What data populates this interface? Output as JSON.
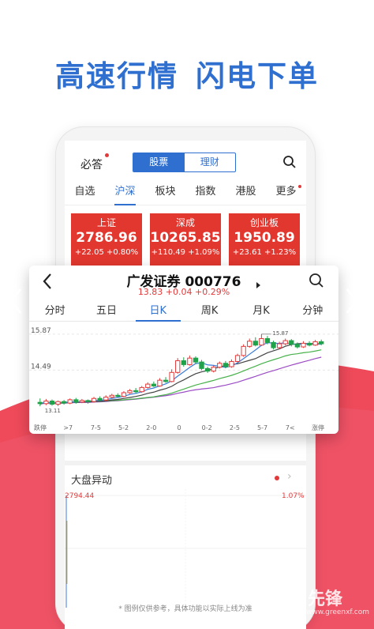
{
  "headline": {
    "left": "高速行情",
    "right": "闪电下单"
  },
  "app": {
    "bida_label": "必答",
    "segment": [
      {
        "label": "股票",
        "active": true
      },
      {
        "label": "理财",
        "active": false
      }
    ],
    "tabs": [
      {
        "label": "自选",
        "active": false
      },
      {
        "label": "沪深",
        "active": true
      },
      {
        "label": "板块",
        "active": false
      },
      {
        "label": "指数",
        "active": false
      },
      {
        "label": "港股",
        "active": false
      },
      {
        "label": "更多",
        "active": false
      }
    ],
    "indices": [
      {
        "name": "上证",
        "value": "2786.96",
        "change": "+22.05",
        "pct": "+0.80%"
      },
      {
        "name": "深成",
        "value": "10265.85",
        "change": "+110.49",
        "pct": "+1.09%"
      },
      {
        "name": "创业板",
        "value": "1950.89",
        "change": "+23.61",
        "pct": "+1.23%"
      }
    ],
    "market_move": {
      "title": "大盘异动",
      "left_value": "2794.44",
      "right_value": "1.07%"
    },
    "disclaimer": "* 图例仅供参考，具体功能以实际上线为准"
  },
  "stock_panel": {
    "title": "广发证券 000776",
    "subtitle": "13.83 +0.04 +0.29%",
    "tabs": [
      {
        "label": "分时",
        "active": false
      },
      {
        "label": "五日",
        "active": false
      },
      {
        "label": "日K",
        "active": true
      },
      {
        "label": "周K",
        "active": false
      },
      {
        "label": "月K",
        "active": false
      },
      {
        "label": "分钟",
        "active": false
      }
    ]
  },
  "chart_data": {
    "type": "candlestick",
    "ylim": [
      12.8,
      16.2
    ],
    "y_ticks": [
      15.87,
      14.49
    ],
    "annotations": {
      "high": "15.87",
      "low": "13.11"
    },
    "x_tick_labels": [
      "跌停",
      ">7",
      "7-5",
      "5-2",
      "2-0",
      "0",
      "0-2",
      "2-5",
      "5-7",
      "7<",
      "涨停"
    ],
    "candles": [
      [
        13.25,
        13.2,
        13.4,
        13.1
      ],
      [
        13.2,
        13.3,
        13.38,
        13.14
      ],
      [
        13.3,
        13.18,
        13.36,
        13.12
      ],
      [
        13.18,
        13.28,
        13.32,
        13.11
      ],
      [
        13.28,
        13.22,
        13.34,
        13.16
      ],
      [
        13.22,
        13.35,
        13.4,
        13.18
      ],
      [
        13.35,
        13.26,
        13.42,
        13.2
      ],
      [
        13.26,
        13.32,
        13.38,
        13.22
      ],
      [
        13.32,
        13.28,
        13.36,
        13.2
      ],
      [
        13.28,
        13.4,
        13.46,
        13.24
      ],
      [
        13.4,
        13.34,
        13.48,
        13.3
      ],
      [
        13.34,
        13.45,
        13.52,
        13.3
      ],
      [
        13.45,
        13.52,
        13.58,
        13.4
      ],
      [
        13.52,
        13.48,
        13.6,
        13.42
      ],
      [
        13.48,
        13.62,
        13.68,
        13.45
      ],
      [
        13.62,
        13.7,
        13.76,
        13.58
      ],
      [
        13.7,
        13.66,
        13.8,
        13.6
      ],
      [
        13.66,
        13.82,
        13.88,
        13.62
      ],
      [
        13.82,
        13.95,
        14.02,
        13.78
      ],
      [
        13.95,
        13.88,
        14.05,
        13.84
      ],
      [
        13.88,
        14.1,
        14.18,
        13.85
      ],
      [
        14.1,
        14.05,
        14.22,
        14.0
      ],
      [
        14.05,
        14.4,
        14.52,
        14.02
      ],
      [
        14.4,
        14.85,
        14.95,
        14.35
      ],
      [
        14.85,
        14.7,
        14.98,
        14.62
      ],
      [
        14.7,
        14.95,
        15.05,
        14.66
      ],
      [
        14.95,
        14.8,
        15.02,
        14.72
      ],
      [
        14.8,
        14.55,
        14.88,
        14.48
      ],
      [
        14.55,
        14.45,
        14.62,
        14.38
      ],
      [
        14.45,
        14.6,
        14.66,
        14.4
      ],
      [
        14.6,
        14.75,
        14.82,
        14.55
      ],
      [
        14.75,
        14.62,
        14.84,
        14.56
      ],
      [
        14.62,
        14.82,
        14.9,
        14.58
      ],
      [
        14.82,
        15.05,
        15.12,
        14.78
      ],
      [
        15.05,
        15.4,
        15.48,
        15.0
      ],
      [
        15.4,
        15.6,
        15.7,
        15.35
      ],
      [
        15.6,
        15.45,
        15.75,
        15.4
      ],
      [
        15.45,
        15.7,
        15.87,
        15.42
      ],
      [
        15.7,
        15.55,
        15.8,
        15.48
      ],
      [
        15.55,
        15.35,
        15.62,
        15.28
      ],
      [
        15.35,
        15.5,
        15.58,
        15.3
      ],
      [
        15.5,
        15.62,
        15.7,
        15.44
      ],
      [
        15.62,
        15.48,
        15.68,
        15.4
      ],
      [
        15.48,
        15.38,
        15.55,
        15.32
      ],
      [
        15.38,
        15.52,
        15.6,
        15.34
      ],
      [
        15.52,
        15.45,
        15.6,
        15.4
      ],
      [
        15.45,
        15.58,
        15.65,
        15.42
      ],
      [
        15.58,
        15.5,
        15.66,
        15.44
      ]
    ],
    "colors": {
      "up": "#e23a3a",
      "down": "#1fa24a",
      "ma5": "#3b7bd8",
      "ma10": "#444444",
      "ma20": "#47b14a",
      "ma60": "#9c4cc4"
    }
  },
  "colors": {
    "accent": "#2f6fd0",
    "rise": "#e23a3a",
    "banner": "#ee4a5a"
  },
  "watermark": {
    "brand": "先锋",
    "url": "www.greenxf.com"
  }
}
